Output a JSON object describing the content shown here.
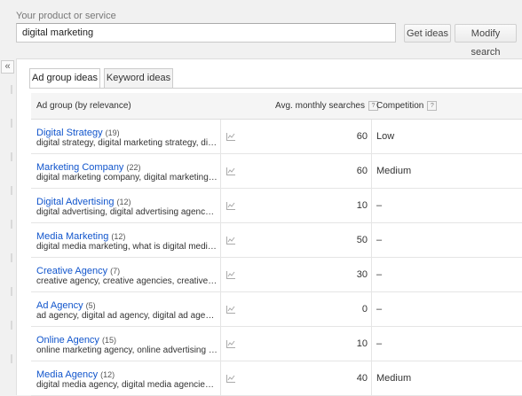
{
  "search": {
    "label": "Your product or service",
    "value": "digital marketing",
    "get_ideas": "Get ideas",
    "modify": "Modify search"
  },
  "collapse": "«",
  "tabs": [
    "Ad group ideas",
    "Keyword ideas"
  ],
  "table": {
    "headers": [
      "Ad group (by relevance)",
      "Avg. monthly searches",
      "Competition"
    ],
    "help_glyph": "?",
    "rows": [
      {
        "name": "Digital Strategy",
        "count": "(19)",
        "keywords": "digital strategy, digital marketing strategy, digit…",
        "avg": "60",
        "competition": "Low"
      },
      {
        "name": "Marketing Company",
        "count": "(22)",
        "keywords": "digital marketing company, digital marketing co…",
        "avg": "60",
        "competition": "Medium"
      },
      {
        "name": "Digital Advertising",
        "count": "(12)",
        "keywords": "digital advertising, digital advertising agency, d…",
        "avg": "10",
        "competition": "–"
      },
      {
        "name": "Media Marketing",
        "count": "(12)",
        "keywords": "digital media marketing, what is digital media …",
        "avg": "50",
        "competition": "–"
      },
      {
        "name": "Creative Agency",
        "count": "(7)",
        "keywords": "creative agency, creative agencies, creative m…",
        "avg": "30",
        "competition": "–"
      },
      {
        "name": "Ad Agency",
        "count": "(5)",
        "keywords": "ad agency, digital ad agency, digital ad agencie…",
        "avg": "0",
        "competition": "–"
      },
      {
        "name": "Online Agency",
        "count": "(15)",
        "keywords": "online marketing agency, online advertising age…",
        "avg": "10",
        "competition": "–"
      },
      {
        "name": "Media Agency",
        "count": "(12)",
        "keywords": "digital media agency, digital media agencies, d…",
        "avg": "40",
        "competition": "Medium"
      }
    ]
  }
}
